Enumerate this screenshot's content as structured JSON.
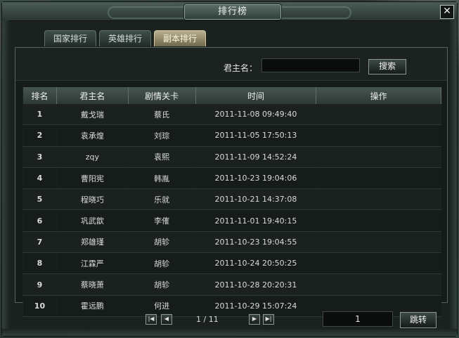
{
  "window": {
    "title": "排行榜",
    "close_glyph": "✕"
  },
  "tabs": [
    {
      "label": "国家排行",
      "active": false
    },
    {
      "label": "英雄排行",
      "active": false
    },
    {
      "label": "副本排行",
      "active": true
    }
  ],
  "search": {
    "label": "君主名：",
    "value": "",
    "button": "搜索"
  },
  "table": {
    "headers": [
      "排名",
      "君主名",
      "剧情关卡",
      "时间",
      "操作"
    ],
    "rows": [
      {
        "rank": "1",
        "name": "戴戈瑞",
        "stage": "蔡氏",
        "time": "2011-11-08 09:49:40",
        "action": ""
      },
      {
        "rank": "2",
        "name": "袁承煌",
        "stage": "刘琮",
        "time": "2011-11-05 17:50:13",
        "action": ""
      },
      {
        "rank": "3",
        "name": "zqy",
        "stage": "袁熙",
        "time": "2011-11-09 14:52:24",
        "action": ""
      },
      {
        "rank": "4",
        "name": "曹阳宪",
        "stage": "韩胤",
        "time": "2011-10-23 19:04:06",
        "action": ""
      },
      {
        "rank": "5",
        "name": "程晓巧",
        "stage": "乐就",
        "time": "2011-10-21 14:37:08",
        "action": ""
      },
      {
        "rank": "6",
        "name": "巩武歆",
        "stage": "李傕",
        "time": "2011-11-01 19:40:15",
        "action": ""
      },
      {
        "rank": "7",
        "name": "郑雄瑾",
        "stage": "胡轸",
        "time": "2011-10-23 19:04:55",
        "action": ""
      },
      {
        "rank": "8",
        "name": "江霖严",
        "stage": "胡轸",
        "time": "2011-10-24 20:50:25",
        "action": ""
      },
      {
        "rank": "9",
        "name": "蔡晓萧",
        "stage": "胡轸",
        "time": "2011-10-28 20:20:31",
        "action": ""
      },
      {
        "rank": "10",
        "name": "霍远鹏",
        "stage": "何进",
        "time": "2011-10-29 15:07:24",
        "action": ""
      }
    ]
  },
  "pager": {
    "first_glyph": "|◀",
    "prev_glyph": "◀",
    "next_glyph": "▶",
    "last_glyph": "▶|",
    "indicator": "1 / 11",
    "jump_value": "1",
    "jump_button": "跳转"
  }
}
